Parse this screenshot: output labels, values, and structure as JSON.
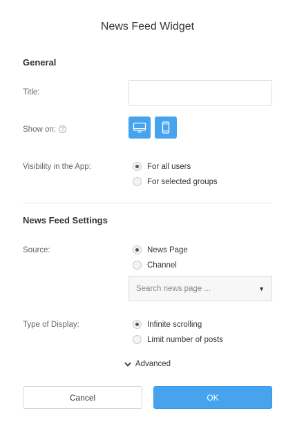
{
  "dialog": {
    "title": "News Feed Widget"
  },
  "general": {
    "heading": "General",
    "title_label": "Title:",
    "title_value": "",
    "show_on_label": "Show on:",
    "help_symbol": "?",
    "devices": [
      {
        "name": "desktop",
        "icon": "desktop-icon",
        "selected": true
      },
      {
        "name": "mobile",
        "icon": "mobile-icon",
        "selected": true
      }
    ],
    "visibility_label": "Visibility in the App:",
    "visibility_options": [
      {
        "label": "For all users",
        "checked": true
      },
      {
        "label": "For selected groups",
        "checked": false
      }
    ]
  },
  "settings": {
    "heading": "News Feed Settings",
    "source_label": "Source:",
    "source_options": [
      {
        "label": "News Page",
        "checked": true
      },
      {
        "label": "Channel",
        "checked": false
      }
    ],
    "search_placeholder": "Search news page ...",
    "display_label": "Type of Display:",
    "display_options": [
      {
        "label": "Infinite scrolling",
        "checked": true
      },
      {
        "label": "Limit number of posts",
        "checked": false
      }
    ]
  },
  "advanced_label": "Advanced",
  "buttons": {
    "cancel": "Cancel",
    "ok": "OK"
  },
  "colors": {
    "accent": "#47a3ee",
    "text": "#333333",
    "label": "#666666",
    "border": "#dcdcdc"
  }
}
